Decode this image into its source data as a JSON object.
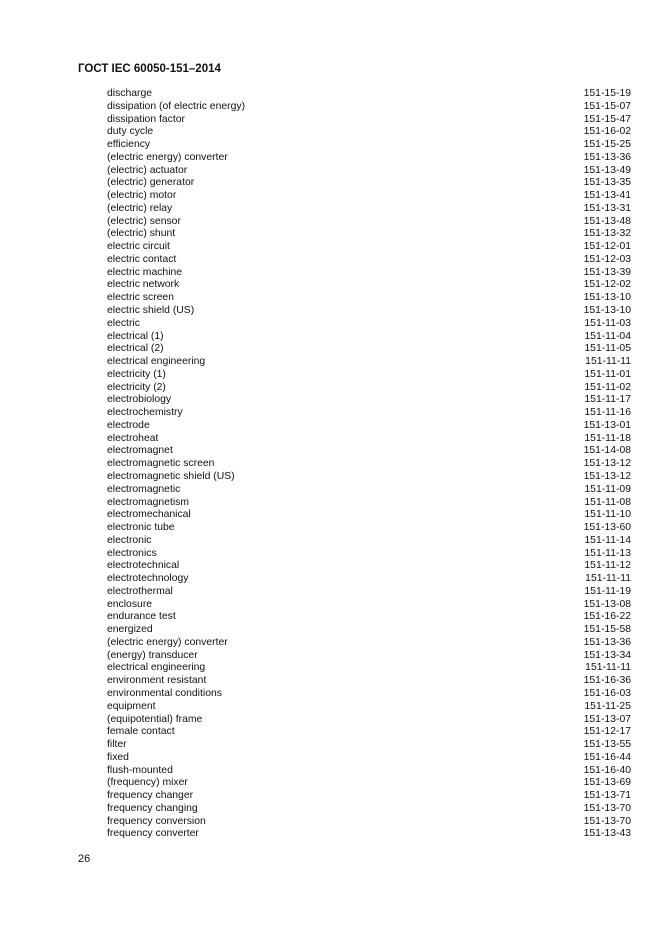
{
  "header": {
    "title": "ГОСТ IEC 60050-151–2014"
  },
  "entries": [
    {
      "term": "discharge",
      "code": "151-15-19"
    },
    {
      "term": "dissipation (of electric energy)",
      "code": "151-15-07"
    },
    {
      "term": "dissipation factor",
      "code": "151-15-47"
    },
    {
      "term": "duty cycle",
      "code": "151-16-02"
    },
    {
      "term": "efficiency",
      "code": "151-15-25"
    },
    {
      "term": "(electric energy) converter",
      "code": "151-13-36"
    },
    {
      "term": "(electric) actuator",
      "code": "151-13-49"
    },
    {
      "term": "(electric) generator",
      "code": "151-13-35"
    },
    {
      "term": "(electric) motor",
      "code": "151-13-41"
    },
    {
      "term": "(electric) relay",
      "code": "151-13-31"
    },
    {
      "term": "(electric) sensor",
      "code": "151-13-48"
    },
    {
      "term": "(electric) shunt",
      "code": "151-13-32"
    },
    {
      "term": "electric circuit",
      "code": "151-12-01"
    },
    {
      "term": "electric contact",
      "code": "151-12-03"
    },
    {
      "term": "electric machine",
      "code": "151-13-39"
    },
    {
      "term": "electric network",
      "code": "151-12-02"
    },
    {
      "term": "electric screen",
      "code": "151-13-10"
    },
    {
      "term": "electric shield (US)",
      "code": "151-13-10"
    },
    {
      "term": "electric",
      "code": "151-11-03"
    },
    {
      "term": "electrical (1)",
      "code": "151-11-04"
    },
    {
      "term": "electrical (2)",
      "code": "151-11-05"
    },
    {
      "term": "electrical engineering",
      "code": "151-11-11"
    },
    {
      "term": "electricity (1)",
      "code": "151-11-01"
    },
    {
      "term": "electricity (2)",
      "code": "151-11-02"
    },
    {
      "term": "electrobiology",
      "code": "151-11-17"
    },
    {
      "term": "electrochemistry",
      "code": "151-11-16"
    },
    {
      "term": "electrode",
      "code": "151-13-01"
    },
    {
      "term": "electroheat",
      "code": "151-11-18"
    },
    {
      "term": "electromagnet",
      "code": "151-14-08"
    },
    {
      "term": "electromagnetic screen",
      "code": "151-13-12"
    },
    {
      "term": "electromagnetic shield (US)",
      "code": "151-13-12"
    },
    {
      "term": "electromagnetic",
      "code": "151-11-09"
    },
    {
      "term": "electromagnetism",
      "code": "151-11-08"
    },
    {
      "term": "electromechanical",
      "code": "151-11-10"
    },
    {
      "term": "electronic tube",
      "code": "151-13-60"
    },
    {
      "term": "electronic",
      "code": "151-11-14"
    },
    {
      "term": "electronics",
      "code": "151-11-13"
    },
    {
      "term": "electrotechnical",
      "code": "151-11-12"
    },
    {
      "term": "electrotechnology",
      "code": "151-11-11"
    },
    {
      "term": "electrothermal",
      "code": "151-11-19"
    },
    {
      "term": "enclosure",
      "code": "151-13-08"
    },
    {
      "term": "endurance test",
      "code": "151-16-22"
    },
    {
      "term": "energized",
      "code": "151-15-58"
    },
    {
      "term": "(electric energy) converter",
      "code": "151-13-36"
    },
    {
      "term": "(energy) transducer",
      "code": "151-13-34"
    },
    {
      "term": "electrical engineering",
      "code": "151-11-11"
    },
    {
      "term": "environment resistant",
      "code": "151-16-36"
    },
    {
      "term": "environmental conditions",
      "code": "151-16-03"
    },
    {
      "term": "equipment",
      "code": "151-11-25"
    },
    {
      "term": "(equipotential) frame",
      "code": "151-13-07"
    },
    {
      "term": "female contact",
      "code": "151-12-17"
    },
    {
      "term": "filter",
      "code": "151-13-55"
    },
    {
      "term": "fixed",
      "code": "151-16-44"
    },
    {
      "term": "flush-mounted",
      "code": "151-16-40"
    },
    {
      "term": "(frequency) mixer",
      "code": "151-13-69"
    },
    {
      "term": "frequency changer",
      "code": "151-13-71"
    },
    {
      "term": "frequency changing",
      "code": "151-13-70"
    },
    {
      "term": "frequency conversion",
      "code": "151-13-70"
    },
    {
      "term": "frequency converter",
      "code": "151-13-43"
    }
  ],
  "footer": {
    "page_number": "26"
  }
}
